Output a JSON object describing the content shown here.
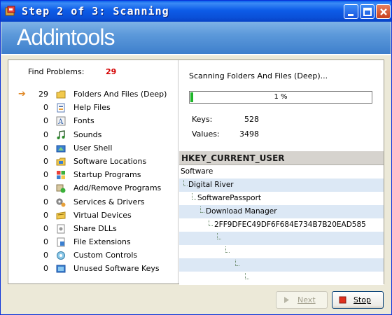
{
  "window": {
    "title": "Step 2 of 3: Scanning",
    "banner_title": "Addintools",
    "colors": {
      "titlebar": "#0A50D8",
      "banner": "#5C99DA",
      "count_red": "#D40000",
      "progress_green": "#1FB52A"
    }
  },
  "find": {
    "label": "Find  Problems:",
    "count": "29"
  },
  "categories": [
    {
      "count": "29",
      "label": "Folders And Files (Deep)",
      "icon": "folder-icon",
      "active": true
    },
    {
      "count": "0",
      "label": "Help Files",
      "icon": "help-file-icon"
    },
    {
      "count": "0",
      "label": "Fonts",
      "icon": "font-icon"
    },
    {
      "count": "0",
      "label": "Sounds",
      "icon": "sound-icon"
    },
    {
      "count": "0",
      "label": "User Shell",
      "icon": "user-shell-icon"
    },
    {
      "count": "0",
      "label": "Software Locations",
      "icon": "software-location-icon"
    },
    {
      "count": "0",
      "label": "Startup Programs",
      "icon": "startup-icon"
    },
    {
      "count": "0",
      "label": "Add/Remove Programs",
      "icon": "add-remove-icon"
    },
    {
      "count": "0",
      "label": "Services & Drivers",
      "icon": "services-icon"
    },
    {
      "count": "0",
      "label": "Virtual Devices",
      "icon": "virtual-device-icon"
    },
    {
      "count": "0",
      "label": "Share DLLs",
      "icon": "dll-icon"
    },
    {
      "count": "0",
      "label": "File Extensions",
      "icon": "file-extension-icon"
    },
    {
      "count": "0",
      "label": "Custom Controls",
      "icon": "custom-control-icon"
    },
    {
      "count": "0",
      "label": "Unused Software Keys",
      "icon": "software-key-icon"
    }
  ],
  "scan": {
    "status": "Scanning Folders And Files (Deep)...",
    "progress_text": "1 %",
    "progress": 0.01,
    "keys_label": "Keys:",
    "keys_value": "528",
    "values_label": "Values:",
    "values_value": "3498"
  },
  "registry": {
    "header": "HKEY_CURRENT_USER",
    "rows": [
      {
        "text": "Software",
        "depth": 0
      },
      {
        "text": "Digital River",
        "depth": 1
      },
      {
        "text": "SoftwarePassport",
        "depth": 2
      },
      {
        "text": "Download Manager",
        "depth": 3
      },
      {
        "text": "2FF9DFEC49DF6F684E734B7B20EAD585",
        "depth": 4
      },
      {
        "text": "",
        "depth": 5
      },
      {
        "text": "",
        "depth": 6
      },
      {
        "text": "",
        "depth": 7
      },
      {
        "text": "",
        "depth": 8
      }
    ]
  },
  "buttons": {
    "next_label": "Next",
    "stop_label": "Stop"
  }
}
